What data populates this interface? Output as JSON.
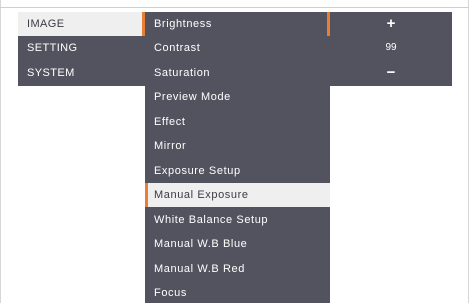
{
  "main_menu": {
    "items": [
      {
        "label": "IMAGE"
      },
      {
        "label": "SETTING"
      },
      {
        "label": "SYSTEM"
      }
    ],
    "selected": "IMAGE"
  },
  "image_submenu": {
    "items": [
      {
        "label": "Brightness"
      },
      {
        "label": "Contrast"
      },
      {
        "label": "Saturation"
      },
      {
        "label": "Preview Mode"
      },
      {
        "label": "Effect"
      },
      {
        "label": "Mirror"
      },
      {
        "label": "Exposure Setup"
      },
      {
        "label": "Manual Exposure"
      },
      {
        "label": "White Balance Setup"
      },
      {
        "label": "Manual W.B Blue"
      },
      {
        "label": "Manual W.B Red"
      },
      {
        "label": "Focus"
      }
    ],
    "selected": "Manual Exposure"
  },
  "value_panel": {
    "increase_label": "+",
    "value": "99",
    "decrease_label": "−"
  },
  "colors": {
    "panel": "#535360",
    "selected_bg": "#efefef",
    "accent": "#e87f33",
    "text": "#ffffff"
  }
}
